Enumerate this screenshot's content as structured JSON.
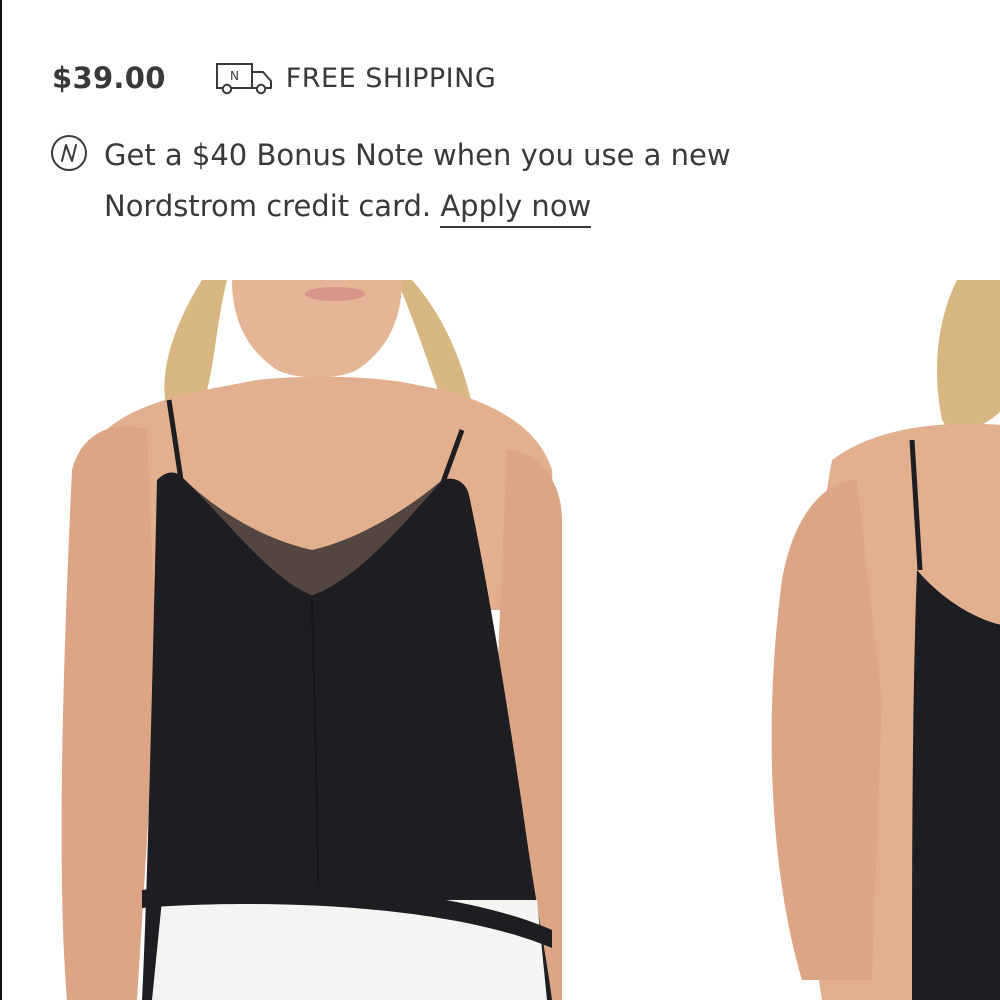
{
  "product": {
    "price": "$39.00",
    "shipping_icon": "delivery-truck-icon",
    "truck_badge_letter": "N",
    "shipping_label": "FREE SHIPPING"
  },
  "promo": {
    "logo_icon": "nordstrom-n-logo-icon",
    "line1": "Get a $40 Bonus Note when you use a new",
    "line2": "Nordstrom credit card. ",
    "link_label": "Apply now"
  },
  "gallery": {
    "images": [
      {
        "name": "product-image-front",
        "description_icon": "black-camisole-front-photo"
      },
      {
        "name": "product-image-back",
        "description_icon": "black-camisole-back-photo"
      }
    ]
  },
  "colors": {
    "text": "#393939",
    "camisole": "#1e1e22",
    "skin": "#e2b08f",
    "hair": "#d8b682",
    "pants": "#f4f4f2"
  }
}
